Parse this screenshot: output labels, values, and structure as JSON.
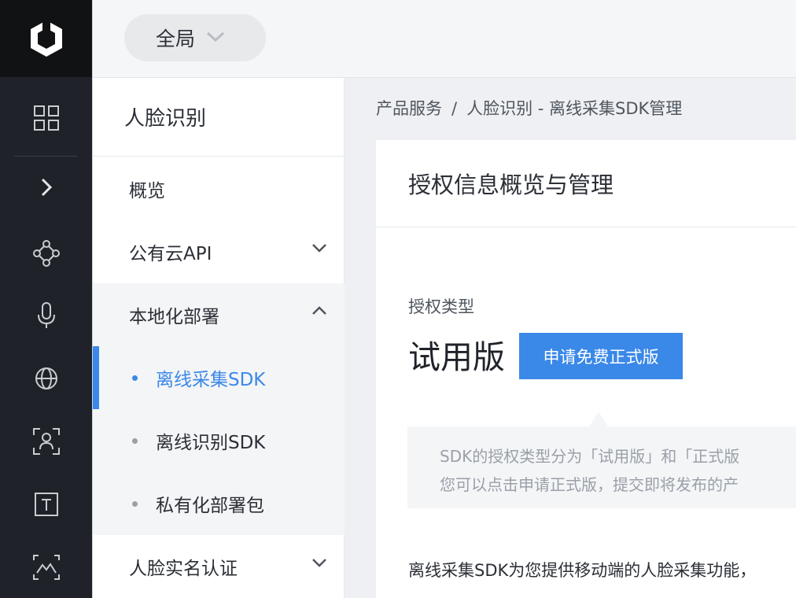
{
  "rail": {
    "icons": [
      "logo-icon",
      "grid-icon",
      "chevron-right-icon",
      "network-icon",
      "microphone-icon",
      "globe-icon",
      "face-scan-icon",
      "text-icon",
      "image-recognition-icon"
    ]
  },
  "topbar": {
    "scope_label": "全局"
  },
  "subnav": {
    "title": "人脸识别",
    "items": [
      {
        "label": "概览"
      },
      {
        "label": "公有云API"
      },
      {
        "label": "本地化部署"
      },
      {
        "label": "离线采集SDK"
      },
      {
        "label": "离线识别SDK"
      },
      {
        "label": "私有化部署包"
      },
      {
        "label": "人脸实名认证"
      }
    ]
  },
  "breadcrumb": {
    "root": "产品服务",
    "separator": "/",
    "current": "人脸识别 - 离线采集SDK管理"
  },
  "card": {
    "title": "授权信息概览与管理",
    "license_label": "授权类型",
    "license_value": "试用版",
    "apply_button": "申请免费正式版",
    "tip_line1": "SDK的授权类型分为「试用版」和「正式版",
    "tip_line2": "您可以点击申请正式版，提交即将发布的产",
    "description": "离线采集SDK为您提供移动端的人脸采集功能，"
  },
  "colors": {
    "accent": "#3a88e8",
    "rail_bg": "#1f2329",
    "logo_bg": "#111214"
  }
}
